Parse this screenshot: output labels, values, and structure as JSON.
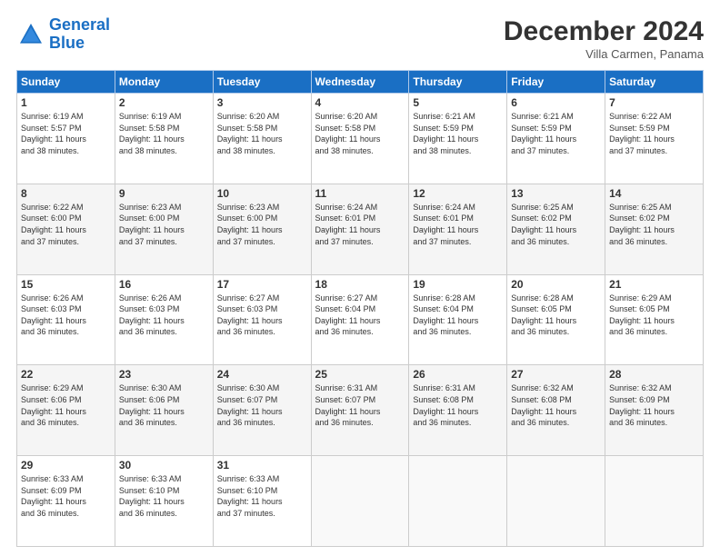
{
  "header": {
    "logo_line1": "General",
    "logo_line2": "Blue",
    "month_title": "December 2024",
    "subtitle": "Villa Carmen, Panama"
  },
  "columns": [
    "Sunday",
    "Monday",
    "Tuesday",
    "Wednesday",
    "Thursday",
    "Friday",
    "Saturday"
  ],
  "weeks": [
    [
      {
        "day": "1",
        "info": "Sunrise: 6:19 AM\nSunset: 5:57 PM\nDaylight: 11 hours\nand 38 minutes."
      },
      {
        "day": "2",
        "info": "Sunrise: 6:19 AM\nSunset: 5:58 PM\nDaylight: 11 hours\nand 38 minutes."
      },
      {
        "day": "3",
        "info": "Sunrise: 6:20 AM\nSunset: 5:58 PM\nDaylight: 11 hours\nand 38 minutes."
      },
      {
        "day": "4",
        "info": "Sunrise: 6:20 AM\nSunset: 5:58 PM\nDaylight: 11 hours\nand 38 minutes."
      },
      {
        "day": "5",
        "info": "Sunrise: 6:21 AM\nSunset: 5:59 PM\nDaylight: 11 hours\nand 38 minutes."
      },
      {
        "day": "6",
        "info": "Sunrise: 6:21 AM\nSunset: 5:59 PM\nDaylight: 11 hours\nand 37 minutes."
      },
      {
        "day": "7",
        "info": "Sunrise: 6:22 AM\nSunset: 5:59 PM\nDaylight: 11 hours\nand 37 minutes."
      }
    ],
    [
      {
        "day": "8",
        "info": "Sunrise: 6:22 AM\nSunset: 6:00 PM\nDaylight: 11 hours\nand 37 minutes."
      },
      {
        "day": "9",
        "info": "Sunrise: 6:23 AM\nSunset: 6:00 PM\nDaylight: 11 hours\nand 37 minutes."
      },
      {
        "day": "10",
        "info": "Sunrise: 6:23 AM\nSunset: 6:00 PM\nDaylight: 11 hours\nand 37 minutes."
      },
      {
        "day": "11",
        "info": "Sunrise: 6:24 AM\nSunset: 6:01 PM\nDaylight: 11 hours\nand 37 minutes."
      },
      {
        "day": "12",
        "info": "Sunrise: 6:24 AM\nSunset: 6:01 PM\nDaylight: 11 hours\nand 37 minutes."
      },
      {
        "day": "13",
        "info": "Sunrise: 6:25 AM\nSunset: 6:02 PM\nDaylight: 11 hours\nand 36 minutes."
      },
      {
        "day": "14",
        "info": "Sunrise: 6:25 AM\nSunset: 6:02 PM\nDaylight: 11 hours\nand 36 minutes."
      }
    ],
    [
      {
        "day": "15",
        "info": "Sunrise: 6:26 AM\nSunset: 6:03 PM\nDaylight: 11 hours\nand 36 minutes."
      },
      {
        "day": "16",
        "info": "Sunrise: 6:26 AM\nSunset: 6:03 PM\nDaylight: 11 hours\nand 36 minutes."
      },
      {
        "day": "17",
        "info": "Sunrise: 6:27 AM\nSunset: 6:03 PM\nDaylight: 11 hours\nand 36 minutes."
      },
      {
        "day": "18",
        "info": "Sunrise: 6:27 AM\nSunset: 6:04 PM\nDaylight: 11 hours\nand 36 minutes."
      },
      {
        "day": "19",
        "info": "Sunrise: 6:28 AM\nSunset: 6:04 PM\nDaylight: 11 hours\nand 36 minutes."
      },
      {
        "day": "20",
        "info": "Sunrise: 6:28 AM\nSunset: 6:05 PM\nDaylight: 11 hours\nand 36 minutes."
      },
      {
        "day": "21",
        "info": "Sunrise: 6:29 AM\nSunset: 6:05 PM\nDaylight: 11 hours\nand 36 minutes."
      }
    ],
    [
      {
        "day": "22",
        "info": "Sunrise: 6:29 AM\nSunset: 6:06 PM\nDaylight: 11 hours\nand 36 minutes."
      },
      {
        "day": "23",
        "info": "Sunrise: 6:30 AM\nSunset: 6:06 PM\nDaylight: 11 hours\nand 36 minutes."
      },
      {
        "day": "24",
        "info": "Sunrise: 6:30 AM\nSunset: 6:07 PM\nDaylight: 11 hours\nand 36 minutes."
      },
      {
        "day": "25",
        "info": "Sunrise: 6:31 AM\nSunset: 6:07 PM\nDaylight: 11 hours\nand 36 minutes."
      },
      {
        "day": "26",
        "info": "Sunrise: 6:31 AM\nSunset: 6:08 PM\nDaylight: 11 hours\nand 36 minutes."
      },
      {
        "day": "27",
        "info": "Sunrise: 6:32 AM\nSunset: 6:08 PM\nDaylight: 11 hours\nand 36 minutes."
      },
      {
        "day": "28",
        "info": "Sunrise: 6:32 AM\nSunset: 6:09 PM\nDaylight: 11 hours\nand 36 minutes."
      }
    ],
    [
      {
        "day": "29",
        "info": "Sunrise: 6:33 AM\nSunset: 6:09 PM\nDaylight: 11 hours\nand 36 minutes."
      },
      {
        "day": "30",
        "info": "Sunrise: 6:33 AM\nSunset: 6:10 PM\nDaylight: 11 hours\nand 36 minutes."
      },
      {
        "day": "31",
        "info": "Sunrise: 6:33 AM\nSunset: 6:10 PM\nDaylight: 11 hours\nand 37 minutes."
      },
      {
        "day": "",
        "info": ""
      },
      {
        "day": "",
        "info": ""
      },
      {
        "day": "",
        "info": ""
      },
      {
        "day": "",
        "info": ""
      }
    ]
  ]
}
